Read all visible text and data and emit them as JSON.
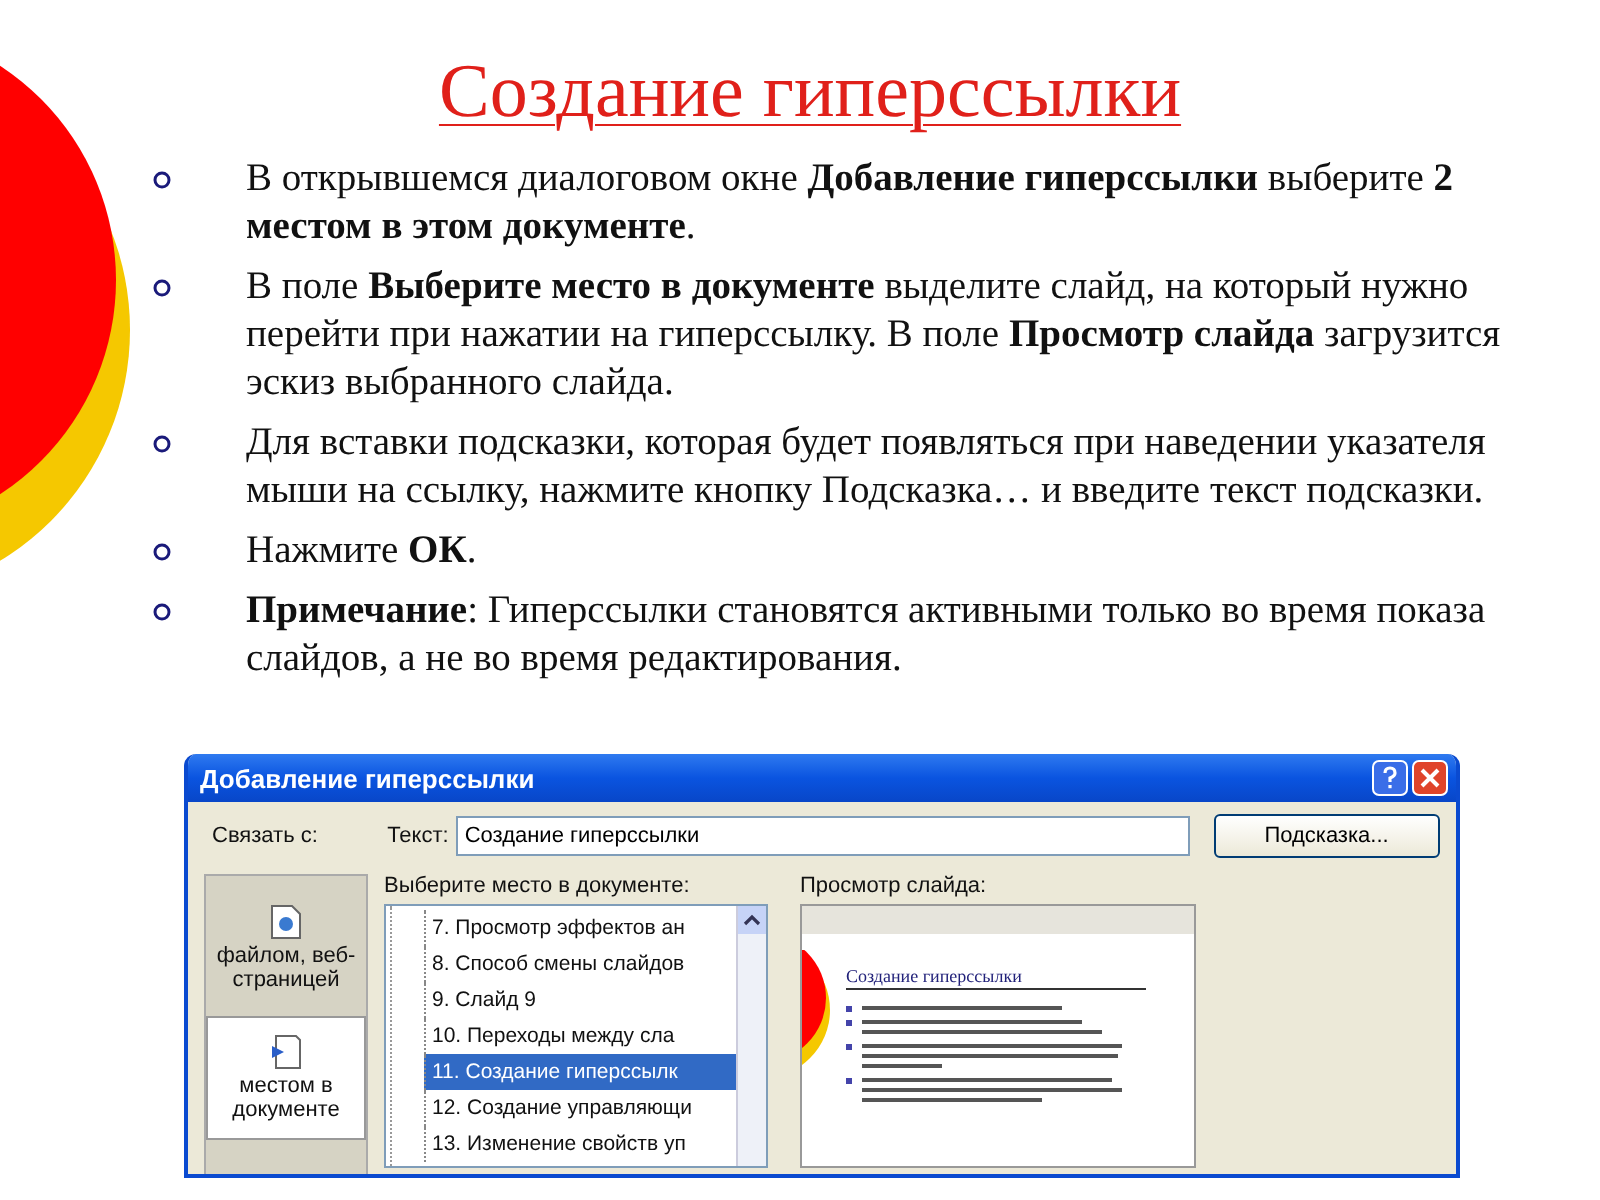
{
  "slide": {
    "title": "Создание гиперссылки",
    "bullets": [
      "В открывшемся диалоговом окне **Добавление гиперссылки** выберите **2 местом в этом документе**.",
      "В поле **Выберите место в документе** выделите слайд, на который нужно перейти при нажатии на гиперссылку. В поле **Просмотр слайда** загрузится эскиз выбранного слайда.",
      "Для вставки подсказки, которая будет появляться при наведении указателя мыши на ссылку, нажмите кнопку Подсказка… и введите текст подсказки.",
      "Нажмите **ОК**.",
      "**Примечание**: Гиперссылки становятся активными только во время показа слайдов, а не во время редактирования."
    ]
  },
  "dialog": {
    "title": "Добавление гиперссылки",
    "link_to_label": "Связать с:",
    "link_options": [
      {
        "label": "файлом, веб-страницей",
        "selected": false
      },
      {
        "label": "местом в документе",
        "selected": true
      }
    ],
    "text_label": "Текст:",
    "text_value": "Создание гиперссылки",
    "hint_button": "Подсказка...",
    "place_label": "Выберите место в документе:",
    "places": [
      {
        "label": "7. Просмотр эффектов ан",
        "selected": false
      },
      {
        "label": "8. Способ смены слайдов",
        "selected": false
      },
      {
        "label": "9. Слайд 9",
        "selected": false
      },
      {
        "label": "10. Переходы между  сла",
        "selected": false
      },
      {
        "label": "11. Создание гиперссылк",
        "selected": true
      },
      {
        "label": "12. Создание управляющи",
        "selected": false
      },
      {
        "label": "13. Изменение свойств уп",
        "selected": false
      }
    ],
    "preview_label": "Просмотр слайда:",
    "preview_title": "Создание гиперссылки"
  }
}
